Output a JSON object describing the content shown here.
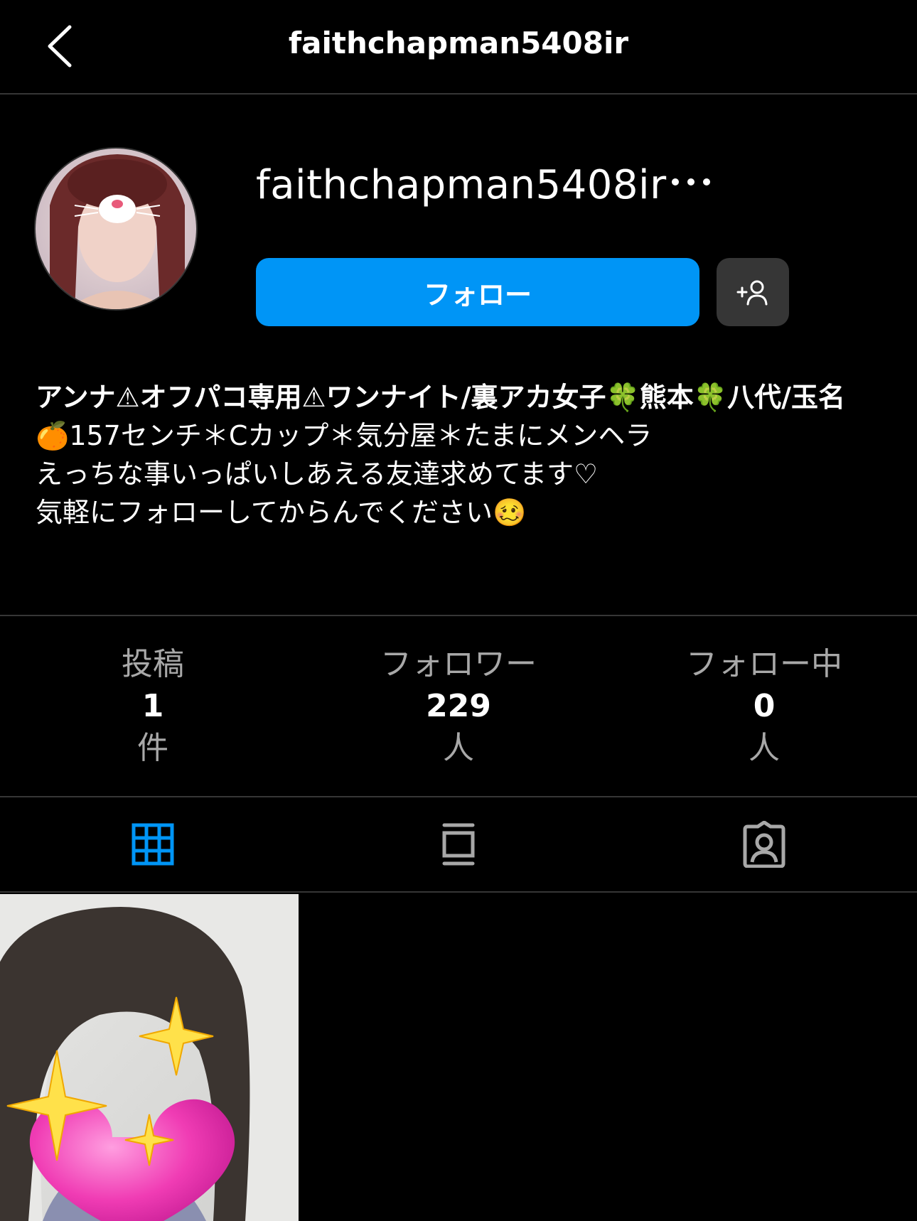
{
  "topbar": {
    "title": "faithchapman5408ir"
  },
  "profile": {
    "username": "faithchapman5408ir",
    "follow_label": "フォロー"
  },
  "bio": {
    "name": "アンナ⚠オフパコ専用⚠ワンナイト/裏アカ女子🍀熊本🍀八代/玉名",
    "lines": [
      "🍊157センチ＊Cカップ＊気分屋＊たまにメンヘラ",
      "えっちな事いっぱいしあえる友達求めてます♡",
      "気軽にフォローしてからんでください🥴"
    ]
  },
  "stats": [
    {
      "label": "投稿",
      "value": "1",
      "unit": "件"
    },
    {
      "label": "フォロワー",
      "value": "229",
      "unit": "人"
    },
    {
      "label": "フォロー中",
      "value": "0",
      "unit": "人"
    }
  ],
  "colors": {
    "accent": "#0095f6",
    "background": "#000000",
    "divider": "#363636",
    "muted": "#a8a8a8"
  },
  "icons": {
    "back": "chevron-left-icon",
    "more": "more-horizontal-icon",
    "suggest": "add-person-icon",
    "tab_posts": "grid-icon",
    "tab_feed": "feed-icon",
    "tab_tagged": "tagged-person-icon"
  }
}
